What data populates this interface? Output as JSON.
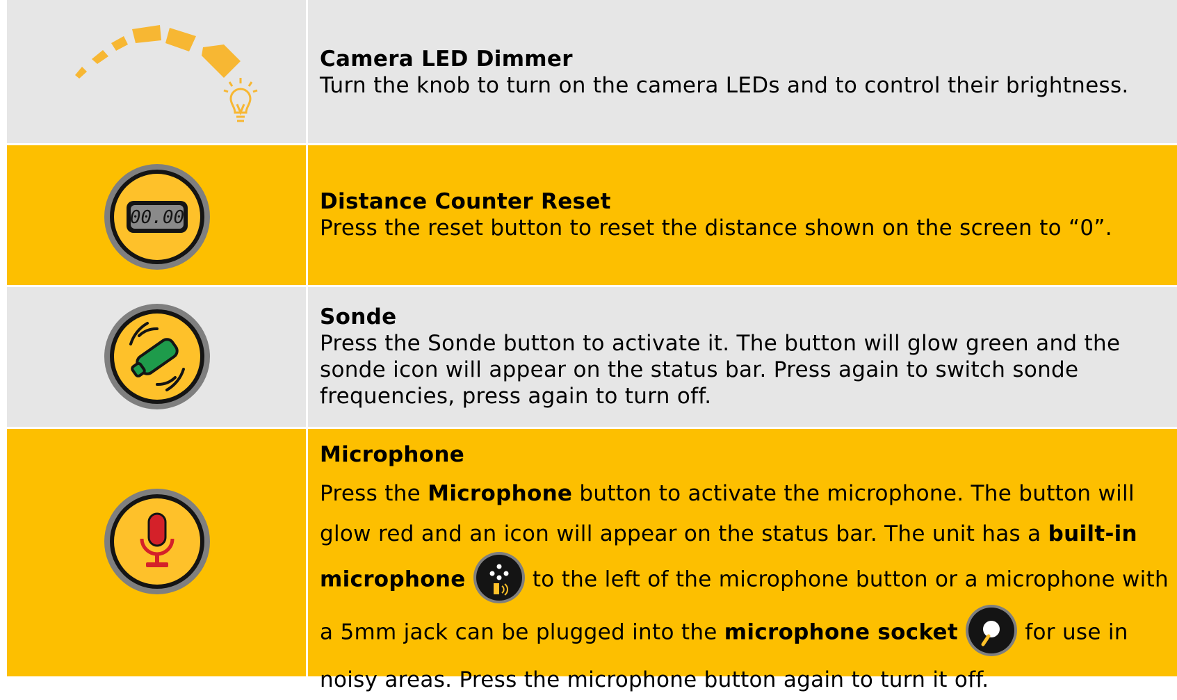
{
  "rows": [
    {
      "title": "Camera LED Dimmer",
      "description": "Turn the knob to turn on the camera LEDs and to control their brightness.",
      "icon": "led-dimmer-arc-bulb-icon"
    },
    {
      "title": "Distance Counter Reset",
      "description": "Press the reset button to reset the distance shown on the screen to “0”.",
      "icon": "distance-counter-icon",
      "counter_display": "00.00"
    },
    {
      "title": "Sonde",
      "description": "Press the Sonde button to activate it. The button will glow green and the sonde icon will appear on the status bar. Press again to switch sonde frequencies, press again to turn off.",
      "icon": "sonde-icon"
    },
    {
      "title": "Microphone",
      "icon": "microphone-icon",
      "parts": {
        "p1": "Press the ",
        "b1": "Microphone",
        "p2": " button to activate the microphone. The button will glow red and an icon will appear on the status bar. The unit has a ",
        "b2": "built-in microphone",
        "p3": " to the left of the microphone button or a microphone with a 5mm jack can be plugged into the ",
        "b3": "microphone socket",
        "p4": " for use in noisy areas. Press the microphone button again to turn it off."
      }
    }
  ],
  "colors": {
    "gray_row": "#e6e6e6",
    "yellow_row": "#fdbf00",
    "icon_yellow": "#fec12a",
    "sonde_green": "#1e9b4b",
    "mic_red": "#d42129"
  }
}
